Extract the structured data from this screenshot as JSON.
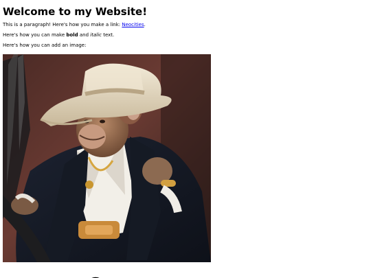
{
  "page": {
    "heading": "Welcome to my Website!",
    "paragraph_1": {
      "text": "This is a paragraph! Here's how you make a link: ",
      "link_text": "Neocities",
      "after_link": "."
    },
    "paragraph_2": {
      "prefix": "Here's how you can make ",
      "bold_text": "bold",
      "middle": " and ",
      "italic_text": "italic",
      "suffix": " text."
    },
    "paragraph_3": {
      "text": "Here's how you can add an image:"
    },
    "image": {
      "subject": "monkey in cowboy hat and dark suit at steering wheel"
    }
  },
  "colors": {
    "link": "#0000ee",
    "text": "#000000",
    "background": "#ffffff"
  }
}
